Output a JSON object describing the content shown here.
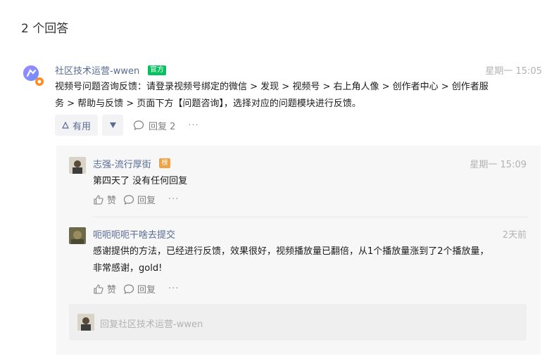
{
  "page": {
    "answers_heading": "2 个回答"
  },
  "answer": {
    "author": "社区技术运营-wwen",
    "badge": "官方",
    "time": "星期一 15:05",
    "body_line1": "视频号问题咨询反馈：请登录视频号绑定的微信 > 发现 > 视频号 > 右上角人像 > 创作者中心 > 创作者服",
    "body_line2": "务 > 帮助与反馈 > 页面下方【问题咨询】，选择对应的问题模块进行反馈。",
    "useful_label": "有用",
    "reply_label": "回复 2",
    "more_label": "···"
  },
  "replies": [
    {
      "author": "志强-流行厚街",
      "rank_badge": "榜",
      "time": "星期一 15:09",
      "text": "第四天了 没有任何回复",
      "like_label": "赞",
      "reply_label": "回复",
      "more_label": "···"
    },
    {
      "author": "呃呃呃呃干啥去提交",
      "time": "2天前",
      "text_line1": "感谢提供的方法，已经进行反馈，效果很好，视频播放量已翻倍，从1个播放量涨到了2个播放量，",
      "text_line2": "非常感谢，gold!",
      "like_label": "赞",
      "reply_label": "回复",
      "more_label": "···"
    }
  ],
  "reply_input": {
    "placeholder": "回复社区技术运营-wwen"
  },
  "colors": {
    "link": "#576b95",
    "official_badge": "#07c160",
    "rank_badge": "#f0a345",
    "muted": "#b2b2b2"
  }
}
